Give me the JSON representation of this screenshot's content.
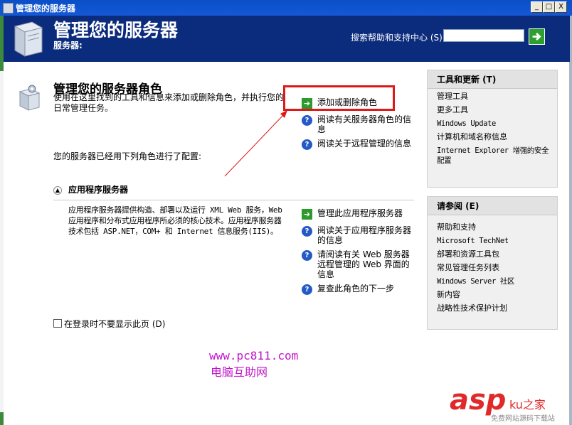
{
  "window": {
    "title": "管理您的服务器",
    "buttons": {
      "minimize": "_",
      "maximize": "□",
      "close": "X"
    }
  },
  "header": {
    "title": "管理您的服务器",
    "subtitle": "服务器:",
    "search_label": "搜索帮助和支持中心 (S)",
    "search_value": ""
  },
  "main": {
    "section_title": "管理您的服务器角色",
    "section_desc": "使用在这里找到的工具和信息来添加或删除角色，并执行您的日常管理任务。",
    "top_actions": [
      {
        "label": "添加或删除角色",
        "icon": "green-arrow-icon"
      },
      {
        "label": "阅读有关服务器角色的信息",
        "icon": "help-icon"
      },
      {
        "label": "阅读关于远程管理的信息",
        "icon": "help-icon"
      }
    ],
    "configured_text": "您的服务器已经用下列角色进行了配置:",
    "role": {
      "title": "应用程序服务器",
      "description": "应用程序服务器提供构造、部署以及运行 XML Web 服务，Web 应用程序和分布式应用程序所必须的核心技术。应用程序服务器技术包括 ASP.NET，COM+ 和 Internet 信息服务(IIS)。",
      "actions": [
        {
          "label": "管理此应用程序服务器",
          "icon": "green-arrow-icon"
        },
        {
          "label": "阅读关于应用程序服务器的信息",
          "icon": "help-icon"
        },
        {
          "label": "请阅读有关 Web 服务器远程管理的 Web 界面的信息",
          "icon": "help-icon"
        },
        {
          "label": "复查此角色的下一步",
          "icon": "help-icon"
        }
      ]
    },
    "checkbox_label": "在登录时不要显示此页 (D)",
    "checkbox_checked": false
  },
  "right_panel": {
    "tools": {
      "title": "工具和更新 (T)",
      "items": [
        "管理工具",
        "更多工具",
        "Windows Update",
        "计算机和域名称信息",
        "Internet Explorer 增强的安全配置"
      ]
    },
    "see_also": {
      "title": "请参阅 (E)",
      "items": [
        "帮助和支持",
        "Microsoft TechNet",
        "部署和资源工具包",
        "常见管理任务列表",
        "Windows Server 社区",
        "新内容",
        "战略性技术保护计划"
      ]
    }
  },
  "watermarks": {
    "site_url": "www.pc811.com",
    "site_name": "电脑互助网",
    "logo_asp": "asp",
    "logo_ku": "ku",
    "logo_home": "之家",
    "logo_tagline": "免费网站源码下载站"
  },
  "colors": {
    "header_bg": "#0b2b7c",
    "highlight": "#e01818",
    "watermark": "#c015c8"
  }
}
